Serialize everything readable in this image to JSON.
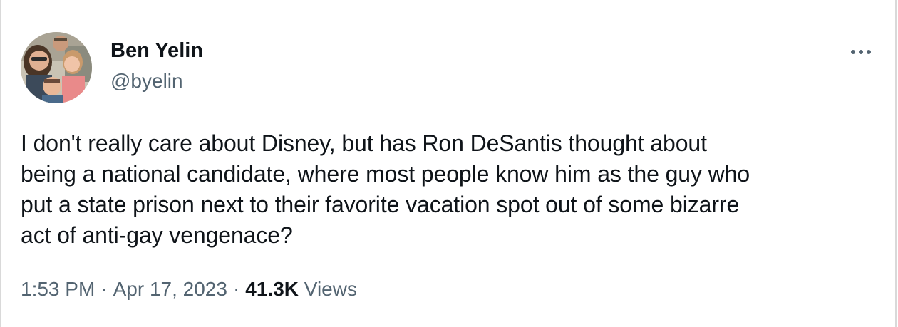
{
  "author": {
    "name": "Ben Yelin",
    "handle": "@byelin",
    "avatar_icon": "profile-photo"
  },
  "menu": {
    "more_icon": "more-horizontal-icon"
  },
  "tweet": {
    "text": "I don't really care about Disney, but has Ron DeSantis thought about\nbeing a national candidate, where most people know him as the guy who\nput a state prison next to their favorite vacation spot out of some bizarre\nact of anti-gay vengenace?"
  },
  "meta": {
    "time": "1:53 PM",
    "separator": "·",
    "date": "Apr 17, 2023",
    "views_count": "41.3K",
    "views_label": "Views"
  },
  "colors": {
    "text_primary": "#0f1419",
    "text_secondary": "#536471",
    "border": "#d9d9d9"
  }
}
